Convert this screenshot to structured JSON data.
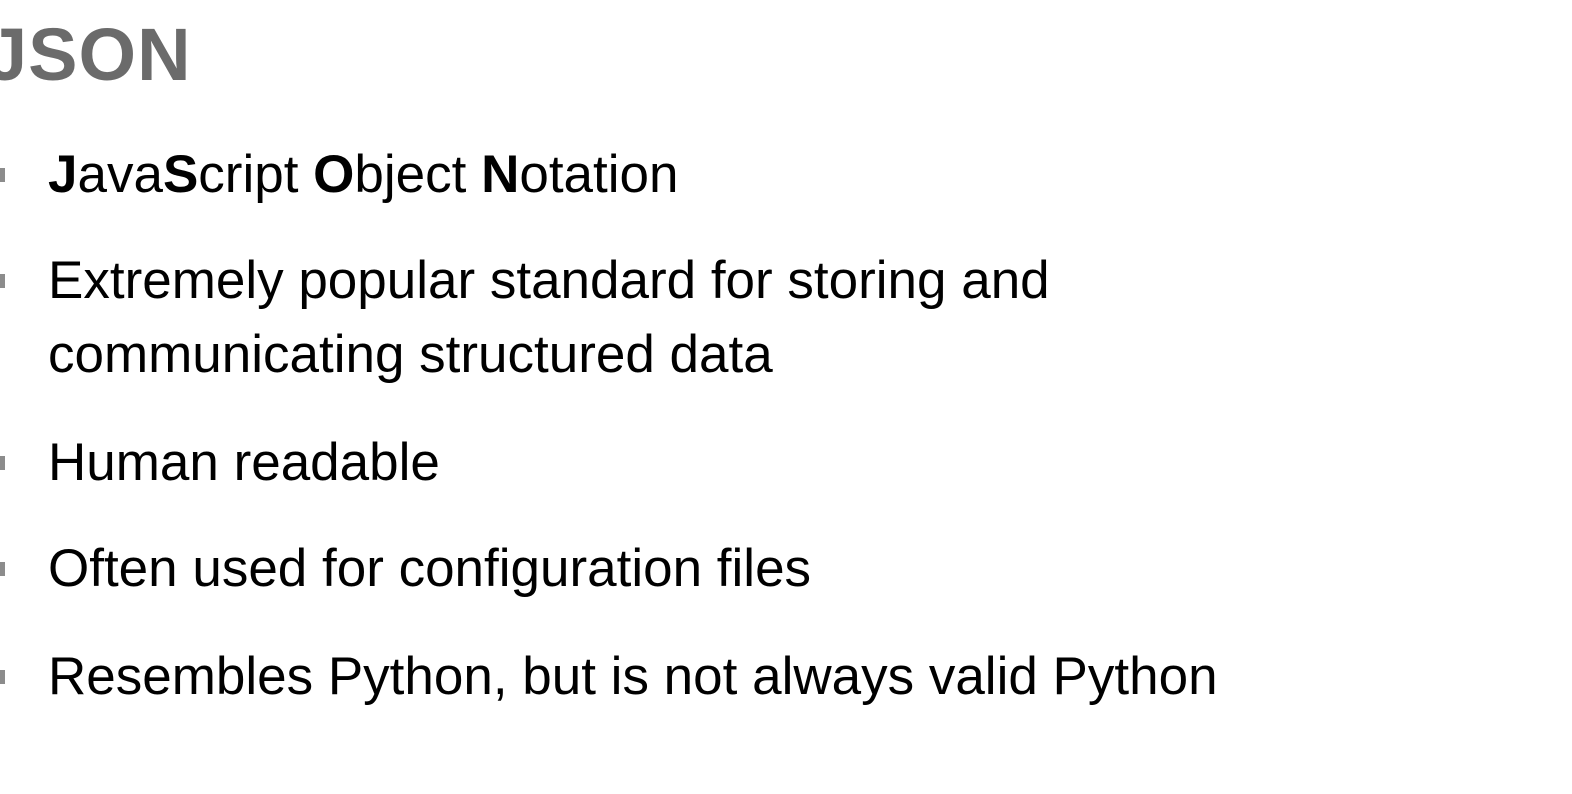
{
  "title": "JSON",
  "colors": {
    "title": "#6b6b6b",
    "text": "#000000",
    "bullet_marker": "#8c8c8c",
    "background": "#ffffff"
  },
  "bullets": [
    {
      "parts": [
        {
          "text": "J",
          "bold": true
        },
        {
          "text": "ava",
          "bold": false
        },
        {
          "text": "S",
          "bold": true
        },
        {
          "text": "cript ",
          "bold": false
        },
        {
          "text": "O",
          "bold": true
        },
        {
          "text": "bject ",
          "bold": false
        },
        {
          "text": "N",
          "bold": true
        },
        {
          "text": "otation",
          "bold": false
        }
      ]
    },
    {
      "lines": [
        "Extremely popular standard for storing and",
        "communicating structured data"
      ]
    },
    {
      "text": "Human readable"
    },
    {
      "text": "Often used for configuration files"
    },
    {
      "text": "Resembles Python, but is not always valid Python"
    }
  ]
}
